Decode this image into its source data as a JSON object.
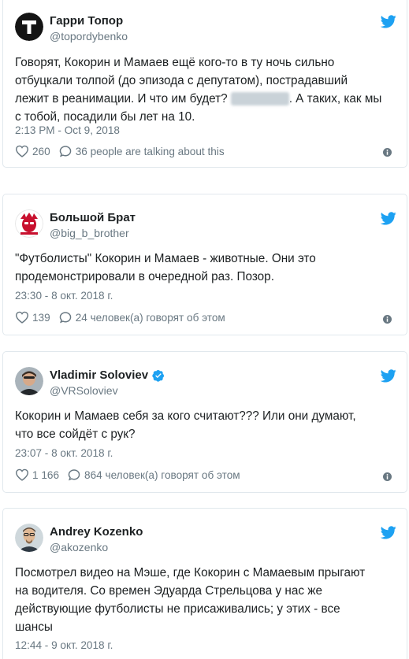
{
  "tweets": [
    {
      "name": "Гарри Топор",
      "handle": "@topordybenko",
      "verified": false,
      "lines": [
        "Говорят, Кокорин и Мамаев ещё кого-то в ту ночь сильно",
        "отбуцкали толпой (до эпизода с депутатом), пострадавший",
        "лежит в реанимации. И что им будет?",
        ". А таких, как мы",
        "с тобой, посадили бы лет на 10."
      ],
      "timestamp": "2:13 PM - Oct 9, 2018",
      "likes": "260",
      "talking": "36 people are talking about this"
    },
    {
      "name": "Большой Брат",
      "handle": "@big_b_brother",
      "verified": false,
      "lines": [
        "\"Футболисты\" Кокорин и Мамаев - животные. Они это",
        "продемонстрировали в очередной раз. Позор."
      ],
      "timestamp": "23:30 - 8 окт. 2018 г.",
      "likes": "139",
      "talking": "24 человек(а) говорят об этом"
    },
    {
      "name": "Vladimir Soloviev",
      "handle": "@VRSoloviev",
      "verified": true,
      "lines": [
        "Кокорин и Мамаев себя за кого считают??? Или они думают,",
        "что все сойдёт с рук?"
      ],
      "timestamp": "23:07 - 8 окт. 2018 г.",
      "likes": "1 166",
      "talking": "864 человек(а) говорят об этом"
    },
    {
      "name": "Andrey Kozenko",
      "handle": "@akozenko",
      "verified": false,
      "lines": [
        "Посмотрел видео на Мэше, где Кокорин с Мамаевым прыгают",
        "на водителя. Со времен Эдуарда Стрельцова у нас же",
        "действующие футболисты не присаживались; у этих - все",
        "шансы"
      ],
      "timestamp": "12:44 - 9 окт. 2018 г."
    }
  ],
  "colors": {
    "twitter_blue": "#1da1f2",
    "text": "#1c2022",
    "muted": "#697882",
    "border": "#e1e8ed"
  },
  "icons": {
    "brand": "twitter-bird-icon",
    "like": "heart-icon",
    "reply": "speech-bubble-icon",
    "info": "info-icon",
    "verified": "verified-badge-icon"
  }
}
